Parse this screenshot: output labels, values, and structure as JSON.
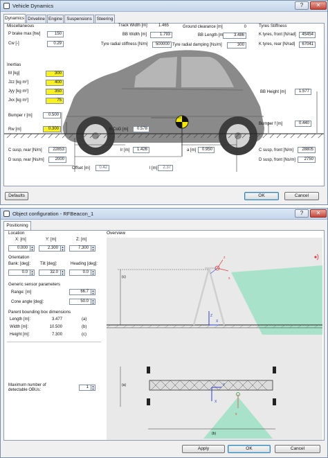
{
  "win1": {
    "title": "Vehicle Dynamics",
    "tabs": [
      "Dynamics",
      "Driveline",
      "Engine",
      "Suspensions",
      "Steering"
    ],
    "miscellaneous": {
      "title": "Miscellaneous",
      "p_brake_label": "P brake max [hw]",
      "p_brake_value": "150",
      "cw_label": "Cw [-]",
      "cw_value": "0.29"
    },
    "top": {
      "track_width_label": "Track Width [m]",
      "track_width_value": "1.465",
      "bb_width_label": "BB Width [m]",
      "bb_width_value": "1.793",
      "ground_clearance_label": "Ground clearance [m]",
      "ground_clearance_value": "0",
      "bb_length_label": "BB Length [m]",
      "bb_length_value": "3.486",
      "tyre_stiff_label": "Tyre radial stiffness [N/m]",
      "tyre_stiff_value": "500000",
      "tyre_damp_label": "Tyre radial damping [Ns/m]",
      "tyre_damp_value": "300"
    },
    "tyres": {
      "title": "Tyres Stiffness",
      "front_label": "K tyres, front [N/rad]",
      "front_value": "45454",
      "rear_label": "K tyres, rear [N/rad]",
      "rear_value": "67041"
    },
    "inertias": {
      "title": "Inertias",
      "m_label": "M [kg]",
      "m_value": "300",
      "jzz_label": "Jzz [kg m²]",
      "jzz_value": "400",
      "jyy_label": "Jyy [kg m²]",
      "jyy_value": "350",
      "jxx_label": "Jxx [kg m²]",
      "jxx_value": "75"
    },
    "bb_height_label": "BB Height [m]",
    "bb_height_value": "1.577",
    "bumper_r_label": "Bumper r [m]",
    "bumper_r_value": "0.500",
    "bumper_f_label": "Bumper f [m]",
    "bumper_f_value": "0.440",
    "rw_label": "Rw [m]",
    "rw_value": "0.300",
    "hcog_label": "h CoG [m]",
    "hcog_value": "0.578",
    "susp": {
      "c_rear_label": "C susp, rear [N/m]",
      "c_rear_value": "22853",
      "d_rear_label": "D susp, rear [Ns/m]",
      "d_rear_value": "2000",
      "c_front_label": "C susp, front [N/m]",
      "c_front_value": "28805",
      "d_front_label": "D susp, front [Ns/m]",
      "d_front_value": "2750"
    },
    "lr_label": "lr [m]",
    "lr_value": "1.426",
    "a_label": "a [m]",
    "a_value": "0.950",
    "offset_label": "Offset [m]",
    "offset_value": "0.42",
    "l_label": "l [m]",
    "l_value": "2.37",
    "buttons": {
      "defaults": "Defaults",
      "ok": "OK",
      "cancel": "Cancel"
    }
  },
  "win2": {
    "title": "Object configuration - RFBeacon_1",
    "tab": "Positioning",
    "overview_label": "Overview",
    "location": {
      "title": "Location",
      "x_label": "X: [m]",
      "y_label": "Y: [m]",
      "z_label": "Z: [m]",
      "x_value": "0.000",
      "y_value": "2.300",
      "z_value": "7.300"
    },
    "orientation": {
      "title": "Orientation",
      "bank_label": "Bank: [deg]:",
      "tilt_label": "Tilt [deg]:",
      "heading_label": "Heading [deg]:",
      "bank_value": "0.0",
      "tilt_value": "32.0",
      "heading_value": "0.0"
    },
    "sensor": {
      "title": "Generic sensor parameters",
      "range_label": "Range: [m]",
      "range_value": "66.7",
      "cone_label": "Cone angle [deg]:",
      "cone_value": "50.0"
    },
    "parent": {
      "title": "Parent bounding box dimensions",
      "length_label": "Length [m]:",
      "length_value": "3.477",
      "length_tag": "(a)",
      "width_label": "Width [m]:",
      "width_value": "10.500",
      "width_tag": "(b)",
      "height_label": "Height [m]:",
      "height_value": "7.300",
      "height_tag": "(c)"
    },
    "obu_label_line1": "Maximum number of",
    "obu_label_line2": "detectable OBUs:",
    "obu_value": "1",
    "diagram": {
      "c_tag": "(c)",
      "a_tag": "(a)",
      "b_tag": "(b)",
      "z": "Z",
      "x": "X",
      "y": "Y"
    },
    "buttons": {
      "apply": "Apply",
      "ok": "OK",
      "cancel": "Cancel"
    }
  },
  "colors": {
    "highlight_yellow": "#f8f020",
    "cone_green": "#9ee0c6",
    "car_gray": "#7d7d7d"
  }
}
